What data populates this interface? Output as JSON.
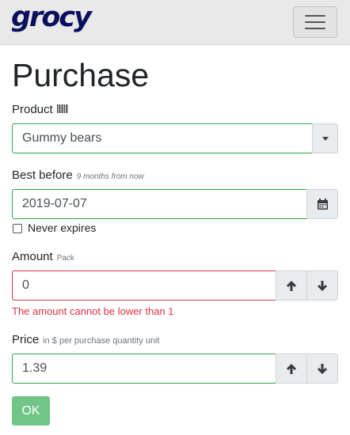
{
  "app": {
    "logo_text": "grocy",
    "menu_icon": "hamburger-icon"
  },
  "page": {
    "title": "Purchase"
  },
  "product": {
    "label": "Product",
    "icon": "barcode-icon",
    "value": "Gummy bears",
    "dropdown_icon": "caret-down-icon"
  },
  "best_before": {
    "label": "Best before",
    "hint": "9 months from now",
    "value": "2019-07-07",
    "icon": "calendar-icon",
    "never_expires_label": "Never expires",
    "never_expires_checked": false
  },
  "amount": {
    "label": "Amount",
    "unit": "Pack",
    "value": "0",
    "error": "The amount cannot be lower than 1",
    "up_icon": "arrow-up-icon",
    "down_icon": "arrow-down-icon"
  },
  "price": {
    "label": "Price",
    "hint": "in $ per purchase quantity unit",
    "value": "1.39",
    "up_icon": "arrow-up-icon",
    "down_icon": "arrow-down-icon"
  },
  "submit": {
    "label": "OK"
  }
}
